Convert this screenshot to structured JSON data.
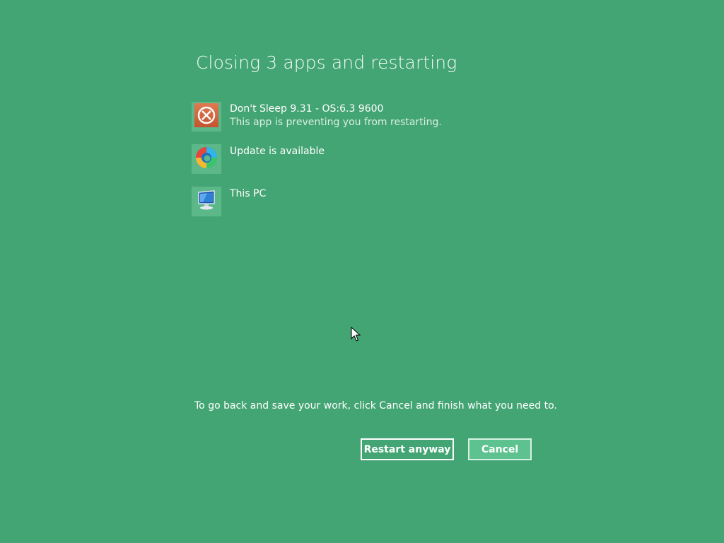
{
  "dialog": {
    "title": "Closing 3 apps and restarting",
    "apps": [
      {
        "name": "Don't Sleep 9.31 - OS:6.3 9600",
        "status": "This app is preventing you from restarting.",
        "icon": "blocked-circle-icon"
      },
      {
        "name": "Update is available",
        "status": "",
        "icon": "edge-browser-icon"
      },
      {
        "name": "This PC",
        "status": "",
        "icon": "computer-monitor-icon"
      }
    ],
    "footer_message": "To go back and save your work, click Cancel and finish what you need to.",
    "buttons": {
      "restart_label": "Restart anyway",
      "cancel_label": "Cancel"
    }
  },
  "colors": {
    "background": "#44a574",
    "icon_tile": "#5cb889",
    "cancel_button": "#5dc28f",
    "text": "#ffffff"
  }
}
